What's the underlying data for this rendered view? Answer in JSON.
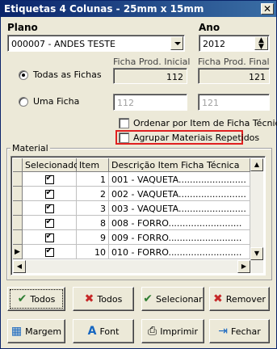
{
  "window": {
    "title": "Etiquetas 4 Colunas - 25mm x 15mm",
    "close": "✕"
  },
  "plano": {
    "label": "Plano",
    "value": "000007 - ANDES TESTE"
  },
  "ano": {
    "label": "Ano",
    "value": "2012"
  },
  "ficha_inicial": {
    "label": "Ficha Prod. Inicial",
    "value": "112",
    "disabled_value": "112"
  },
  "ficha_final": {
    "label": "Ficha Prod. Final",
    "value": "121",
    "disabled_value": "121"
  },
  "radios": {
    "todas": "Todas as Fichas",
    "uma": "Uma Ficha",
    "selected": "todas"
  },
  "checks": {
    "ordenar": "Ordenar por Item de Ficha Técnica",
    "agrupar": "Agrupar Materiais Repetidos"
  },
  "material": {
    "group_label": "Material",
    "columns": [
      "Selecionado",
      "Item",
      "Descrição Item Ficha Técnica"
    ],
    "rows": [
      {
        "item": "1",
        "desc": "001 - VAQUETA........................"
      },
      {
        "item": "2",
        "desc": "002 - VAQUETA........................"
      },
      {
        "item": "3",
        "desc": "003 - VAQUETA........................"
      },
      {
        "item": "8",
        "desc": "008 - FORRO.........................."
      },
      {
        "item": "9",
        "desc": "009 - FORRO.........................."
      },
      {
        "item": "10",
        "desc": "010 - FORRO.........................."
      }
    ]
  },
  "buttons": {
    "todos_check": "Todos",
    "todos_x": "Todos",
    "selecionar": "Selecionar",
    "remover": "Remover",
    "margem": "Margem",
    "font": "Font",
    "imprimir": "Imprimir",
    "fechar": "Fechar"
  },
  "icons": {
    "check": "✔",
    "x": "✖",
    "selecionar": "✔",
    "remover": "✖",
    "margem": "▦",
    "font": "A",
    "imprimir": "⎙",
    "fechar": "⇥"
  }
}
